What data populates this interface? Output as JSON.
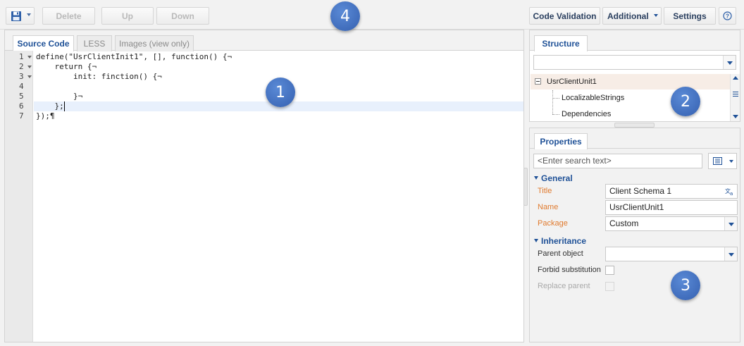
{
  "toolbar": {
    "delete_label": "Delete",
    "up_label": "Up",
    "down_label": "Down",
    "code_validation_label": "Code Validation",
    "additional_label": "Additional",
    "settings_label": "Settings",
    "save_icon": "floppy-disk-icon",
    "help_icon": "question-icon"
  },
  "badges": {
    "b1": "1",
    "b2": "2",
    "b3": "3",
    "b4": "4"
  },
  "editor": {
    "tabs": [
      "Source Code",
      "LESS",
      "Images (view only)"
    ],
    "line_numbers": [
      "1",
      "2",
      "3",
      "4",
      "5",
      "6",
      "7"
    ],
    "lines": [
      "define(\"UsrClientInit1\", [], function() {¬",
      "    return {¬",
      "        init: finction() {¬",
      "",
      "        }¬",
      "    };",
      "});¶"
    ]
  },
  "structure": {
    "tab_label": "Structure",
    "tree": [
      {
        "label": "UsrClientUnit1"
      },
      {
        "label": "LocalizableStrings"
      },
      {
        "label": "Dependencies"
      }
    ]
  },
  "properties": {
    "tab_label": "Properties",
    "search_placeholder": "<Enter search text>",
    "general_label": "General",
    "inheritance_label": "Inheritance",
    "fields": {
      "title_label": "Title",
      "title_value": "Client Schema 1",
      "name_label": "Name",
      "name_value": "UsrClientUnit1",
      "package_label": "Package",
      "package_value": "Custom",
      "parent_label": "Parent object",
      "parent_value": "",
      "forbid_label": "Forbid substitution",
      "replace_label": "Replace parent"
    }
  },
  "colors": {
    "accent": "#1f5197",
    "required_label": "#e07a2e",
    "badge": "#3d6bbf"
  }
}
